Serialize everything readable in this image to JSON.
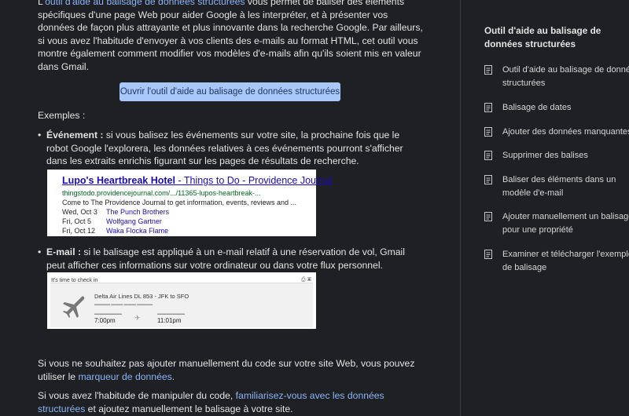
{
  "intro": {
    "link": "outil d'aide au balisage de données structurées",
    "prefix": "L'",
    "text": " vous permet de baliser des éléments spécifiques d'une page Web pour aider Google à les interpréter, et à présenter vos données de façon plus attrayante et plus innovante dans la recherche Google. Par ailleurs, si vous avez l'habitude d'envoyer à vos clients des e-mails au format HTML, cet outil vous montre également comment modifier vos modèles d'e-mails afin qu'ils soient mis en valeur dans Gmail."
  },
  "open_button": "Ouvrir l'outil d'aide au balisage de données structurées",
  "examples_heading": "Exemples :",
  "bullet_event": {
    "label": "Événement :",
    "text": " si vous balisez les événements sur votre site, la prochaine fois que le robot Google l'explorera, les données relatives à ces événements pourront s'afficher dans les extraits enrichis figurant sur les pages de résultats de recherche."
  },
  "serp": {
    "title_bold": "Lupo's Heartbreak Hotel",
    "title_rest": " - Things to Do - Providence Journal",
    "url": "thingstodo.providencejournal.com/.../11365-lupos-heartbreak-...",
    "snippet": "Come to The Providence Journal to get information, events, reviews and ...",
    "events": [
      {
        "date": "Wed, Oct 3",
        "name": "The Punch Brothers"
      },
      {
        "date": "Fri, Oct 5",
        "name": "Wolfgang Gartner"
      },
      {
        "date": "Fri, Oct 12",
        "name": "Waka Flocka Flame"
      }
    ]
  },
  "bullet_email": {
    "label": "E-mail :",
    "text": " si le balisage est appliqué à un e-mail relatif à une réservation de vol, Gmail peut afficher ces informations sur votre ordinateur ou dans votre flux personnel."
  },
  "email": {
    "header": "It's time to check in",
    "flight": "Delta Air Lines DL 853 - JFK to SFO",
    "depart_time": "7:00pm",
    "arrive_time": "11:01pm"
  },
  "para_a": {
    "text": "Si vous ne souhaitez pas ajouter manuellement du code sur votre site Web, vous pouvez utiliser le ",
    "link": "marqueur de données",
    "end": "."
  },
  "para_b": {
    "text": "Si vous avez l'habitude de manipuler du code, ",
    "link": "familiarisez-vous avec les données structurées",
    "end": " et ajoutez manuellement le balisage à votre site."
  },
  "sidebar": {
    "title": "Outil d'aide au balisage de données structurées",
    "items": [
      {
        "label": "Outil d'aide au balisage de données structurées"
      },
      {
        "label": "Balisage de dates"
      },
      {
        "label": "Ajouter des données manquantes"
      },
      {
        "label": "Supprimer des balises"
      },
      {
        "label": "Baliser des éléments dans un modèle d'e-mail"
      },
      {
        "label": "Ajouter manuellement un balisage pour une propriété"
      },
      {
        "label": "Examiner et télécharger l'exemple de balisage"
      }
    ]
  },
  "colors": {
    "link": "#8ab4f8",
    "button_bg": "#a8c7fa",
    "background": "#1f2023"
  }
}
